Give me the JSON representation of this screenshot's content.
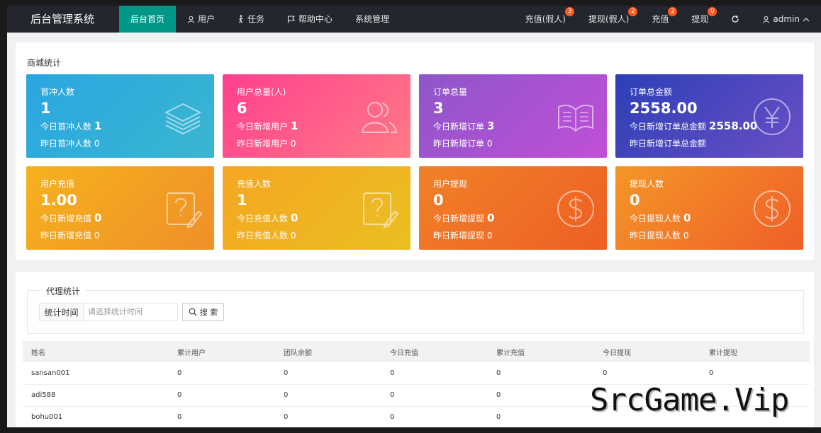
{
  "header": {
    "logo": "后台管理系统",
    "nav": [
      {
        "label": "后台首页",
        "icon": "",
        "active": true
      },
      {
        "label": "用户",
        "icon": "user-icon",
        "active": false
      },
      {
        "label": "任务",
        "icon": "walk-icon",
        "active": false
      },
      {
        "label": "帮助中心",
        "icon": "flag-icon",
        "active": false
      },
      {
        "label": "系统管理",
        "icon": "",
        "active": false
      }
    ],
    "right": [
      {
        "label": "充值(假人)",
        "badge": "3"
      },
      {
        "label": "提现(假人)",
        "badge": "2"
      },
      {
        "label": "充值",
        "badge": "2"
      },
      {
        "label": "提现",
        "badge": "0"
      }
    ],
    "refresh_icon": "refresh-icon",
    "user": "admin"
  },
  "stats": {
    "title": "商城统计",
    "cards": [
      {
        "title": "首冲人数",
        "value": "1",
        "line1_label": "今日首冲人数",
        "line1_value": "1",
        "line2": "昨日首冲人数 0",
        "icon": "layers-icon"
      },
      {
        "title": "用户总量(人)",
        "value": "6",
        "line1_label": "今日新增用户",
        "line1_value": "1",
        "line2": "昨日新增用户 0",
        "icon": "users-icon"
      },
      {
        "title": "订单总量",
        "value": "3",
        "line1_label": "今日新增订单",
        "line1_value": "3",
        "line2": "昨日新增订单 0",
        "icon": "book-icon"
      },
      {
        "title": "订单总金额",
        "value": "2558.00",
        "line1_label": "今日新增订单总金额",
        "line1_value": "2558.00",
        "line2": "昨日新增订单总金额",
        "icon": "yen-icon"
      },
      {
        "title": "用户充值",
        "value": "1.00",
        "line1_label": "今日新增充值",
        "line1_value": "0",
        "line2": "昨日新增充值 0",
        "icon": "question-edit-icon"
      },
      {
        "title": "充值人数",
        "value": "1",
        "line1_label": "今日充值人数",
        "line1_value": "0",
        "line2": "昨日充值人数 0",
        "icon": "question-edit-icon"
      },
      {
        "title": "用户提现",
        "value": "0",
        "line1_label": "今日新增提现",
        "line1_value": "0",
        "line2": "昨日新增提现 0",
        "icon": "dollar-icon"
      },
      {
        "title": "提现人数",
        "value": "0",
        "line1_label": "今日提现人数",
        "line1_value": "0",
        "line2": "昨日提现人数 0",
        "icon": "dollar-icon"
      }
    ]
  },
  "agent": {
    "legend": "代理统计",
    "field_label": "统计时间",
    "field_placeholder": "请选择统计时间",
    "search_label": "搜 索",
    "columns": [
      "姓名",
      "累计用户",
      "团队余额",
      "今日充值",
      "累计充值",
      "今日提现",
      "累计提现"
    ],
    "rows": [
      [
        "sansan001",
        "0",
        "0",
        "0",
        "0",
        "0",
        "0"
      ],
      [
        "adi588",
        "0",
        "0",
        "0",
        "0",
        "",
        "0"
      ],
      [
        "bohu001",
        "0",
        "0",
        "0",
        "0",
        "",
        ""
      ]
    ]
  },
  "watermark": "SrcGame.Vip"
}
